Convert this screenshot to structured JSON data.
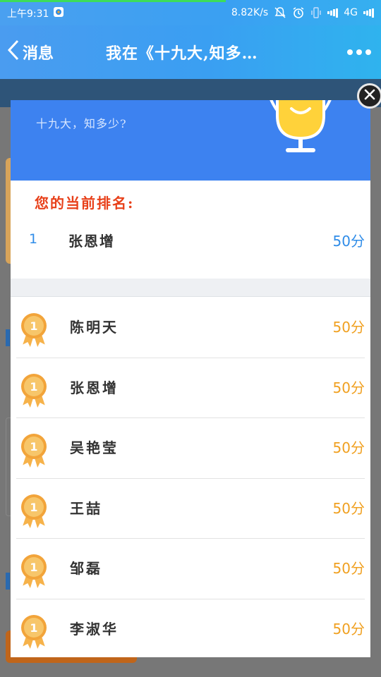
{
  "status_bar": {
    "time": "上午9:31",
    "network_speed": "8.82K/s",
    "network_type": "4G",
    "icons": [
      "app-notification-icon",
      "mute-icon",
      "alarm-icon",
      "vibrate-icon",
      "signal-icon",
      "signal-icon"
    ]
  },
  "nav": {
    "back_label": "消息",
    "title": "我在《十九大,知多…",
    "more_icon": "more-dots-icon"
  },
  "modal": {
    "quiz_title": "十九大，知多少?",
    "current_label": "您的当前排名:",
    "current": {
      "rank": "1",
      "name": "张恩增",
      "score": "50分"
    },
    "medal_number": "1",
    "leaderboard": [
      {
        "name": "陈明天",
        "score": "50分"
      },
      {
        "name": "张恩增",
        "score": "50分"
      },
      {
        "name": "吴艳莹",
        "score": "50分"
      },
      {
        "name": "王喆",
        "score": "50分"
      },
      {
        "name": "邹磊",
        "score": "50分"
      },
      {
        "name": "李淑华",
        "score": "50分"
      }
    ],
    "close_icon": "close-icon"
  },
  "colors": {
    "header_blue": "#3d82f0",
    "rank_label_red": "#e8401a",
    "score_orange": "#f0a020",
    "current_blue": "#2f8ce8",
    "medal_gold": "#f2a43a"
  }
}
